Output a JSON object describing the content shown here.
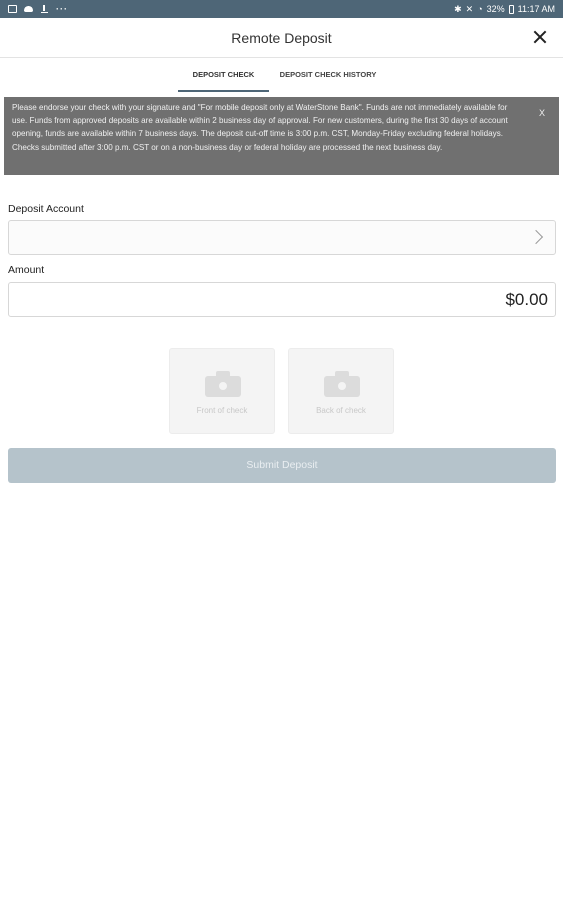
{
  "status_bar": {
    "left_icons": [
      "image-icon",
      "cloud-icon",
      "download-icon",
      "more-icon"
    ],
    "more_glyph": "···",
    "right_text": "32%",
    "time": "11:17 AM"
  },
  "header": {
    "title": "Remote Deposit",
    "close_icon": "close-icon"
  },
  "tabs": [
    {
      "label": "Deposit Check",
      "active": true
    },
    {
      "label": "Deposit Check History",
      "active": false
    }
  ],
  "notice": {
    "text": "Please endorse your check with your signature and \"For mobile deposit only at WaterStone Bank\". Funds are not immediately available for use. Funds from approved deposits are available within 2 business day of approval. For new customers, during the first 30 days of account opening, funds are available within 7 business days. The deposit cut-off time is 3:00 p.m. CST, Monday-Friday excluding federal holidays. Checks submitted after 3:00 p.m. CST or on a non-business day or federal holiday are processed the next business day.",
    "close_label": "X"
  },
  "form": {
    "deposit_account_label": "Deposit Account",
    "deposit_account_value": "",
    "amount_label": "Amount",
    "amount_value": "$0.00"
  },
  "check_capture": {
    "front_label": "Front of check",
    "back_label": "Back of check"
  },
  "submit": {
    "label": "Submit Deposit",
    "enabled": false
  },
  "colors": {
    "status_bar": "#4e6677",
    "notice_bg": "#707070",
    "submit_disabled": "#b5c3cb"
  }
}
